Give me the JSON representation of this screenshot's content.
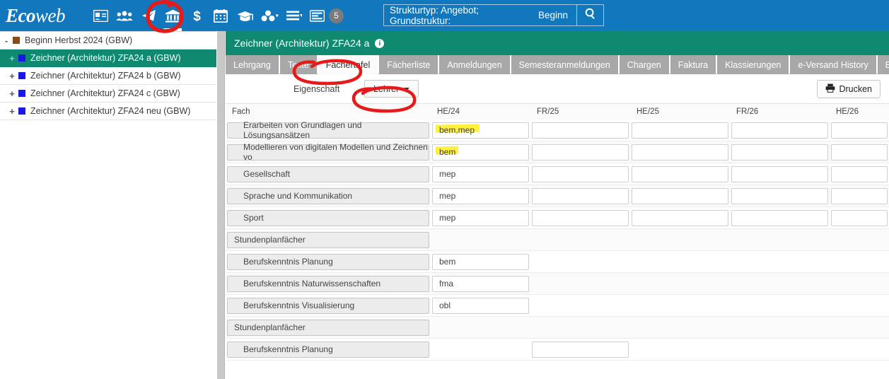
{
  "app": {
    "brand_eco": "Eco",
    "brand_web": "web"
  },
  "topbar": {
    "icons": [
      {
        "name": "id-card-icon",
        "label": "Kontakte"
      },
      {
        "name": "users-icon",
        "label": "Personengruppen"
      },
      {
        "name": "paper-plane-icon",
        "label": "Versand"
      },
      {
        "name": "bank-icon",
        "label": "Institution"
      },
      {
        "name": "dollar-icon",
        "label": "Finanzen"
      },
      {
        "name": "calendar-icon",
        "label": "Kalender"
      },
      {
        "name": "graduation-cap-icon",
        "label": "Ausbildung"
      },
      {
        "name": "sitemap-icon",
        "label": "Struktur"
      },
      {
        "name": "list-icon",
        "label": "Listen"
      },
      {
        "name": "tasks-icon",
        "label": "Aufgaben"
      }
    ],
    "badge_count": "5"
  },
  "search": {
    "label": "Strukturtyp: Angebot; Grundstruktur:",
    "value": "Beginn",
    "button_icon": "search-icon"
  },
  "sidebar": {
    "nodes": [
      {
        "label": "Beginn Herbst 2024 (GBW)",
        "expander": "-",
        "color": "brown",
        "level": 1,
        "selected": false
      },
      {
        "label": "Zeichner (Architektur) ZFA24 a (GBW)",
        "expander": "+",
        "color": "blue",
        "level": 2,
        "selected": true
      },
      {
        "label": "Zeichner (Architektur) ZFA24 b (GBW)",
        "expander": "+",
        "color": "blue",
        "level": 2,
        "selected": false
      },
      {
        "label": "Zeichner (Architektur) ZFA24 c (GBW)",
        "expander": "+",
        "color": "blue",
        "level": 2,
        "selected": false
      },
      {
        "label": "Zeichner (Architektur) ZFA24 neu (GBW)",
        "expander": "+",
        "color": "blue",
        "level": 2,
        "selected": false
      }
    ]
  },
  "panel": {
    "title": "Zeichner (Architektur) ZFA24 a",
    "info_icon": "info-icon",
    "tabs": [
      {
        "label": "Lehrgang",
        "active": false
      },
      {
        "label": "Texte",
        "active": false
      },
      {
        "label": "Fächertafel",
        "active": true
      },
      {
        "label": "Fächerliste",
        "active": false
      },
      {
        "label": "Anmeldungen",
        "active": false
      },
      {
        "label": "Semesteranmeldungen",
        "active": false
      },
      {
        "label": "Chargen",
        "active": false
      },
      {
        "label": "Faktura",
        "active": false
      },
      {
        "label": "Klassierungen",
        "active": false
      },
      {
        "label": "e-Versand History",
        "active": false
      },
      {
        "label": "Berichte",
        "active": false
      }
    ],
    "toolbar": {
      "eigenschaft_label": "Eigenschaft",
      "dropdown_value": "Lehrer",
      "print_label": "Drucken",
      "print_icon": "printer-icon"
    }
  },
  "table": {
    "columns": [
      "Fach",
      "HE/24",
      "FR/25",
      "HE/25",
      "FR/26",
      "HE/26"
    ],
    "rows": [
      {
        "fach": "Erarbeiten von Grundlagen und Lösungsansätzen",
        "indent": true,
        "group": false,
        "values": [
          "bem,mep",
          "",
          "",
          "",
          ""
        ],
        "boxes": [
          true,
          true,
          true,
          true,
          true
        ],
        "highlight": 0
      },
      {
        "fach": "Modellieren von digitalen Modellen und Zeichnen vo",
        "indent": true,
        "group": false,
        "values": [
          "bem",
          "",
          "",
          "",
          ""
        ],
        "boxes": [
          true,
          true,
          true,
          true,
          true
        ],
        "highlight": 0
      },
      {
        "fach": "Gesellschaft",
        "indent": true,
        "group": false,
        "values": [
          "mep",
          "",
          "",
          "",
          ""
        ],
        "boxes": [
          true,
          true,
          true,
          true,
          true
        ],
        "highlight": -1
      },
      {
        "fach": "Sprache und Kommunikation",
        "indent": true,
        "group": false,
        "values": [
          "mep",
          "",
          "",
          "",
          ""
        ],
        "boxes": [
          true,
          true,
          true,
          true,
          true
        ],
        "highlight": -1
      },
      {
        "fach": "Sport",
        "indent": true,
        "group": false,
        "values": [
          "mep",
          "",
          "",
          "",
          ""
        ],
        "boxes": [
          true,
          true,
          true,
          true,
          true
        ],
        "highlight": -1
      },
      {
        "fach": "Stundenplanfächer",
        "indent": false,
        "group": true,
        "values": [
          "",
          "",
          "",
          "",
          ""
        ],
        "boxes": [
          false,
          false,
          false,
          false,
          false
        ],
        "highlight": -1
      },
      {
        "fach": "Berufskenntnis Planung",
        "indent": true,
        "group": false,
        "values": [
          "bem",
          "",
          "",
          "",
          ""
        ],
        "boxes": [
          true,
          false,
          false,
          false,
          false
        ],
        "highlight": -1
      },
      {
        "fach": "Berufskenntnis Naturwissenschaften",
        "indent": true,
        "group": false,
        "values": [
          "fma",
          "",
          "",
          "",
          ""
        ],
        "boxes": [
          true,
          false,
          false,
          false,
          false
        ],
        "highlight": -1
      },
      {
        "fach": "Berufskenntnis Visualisierung",
        "indent": true,
        "group": false,
        "values": [
          "obl",
          "",
          "",
          "",
          ""
        ],
        "boxes": [
          true,
          false,
          false,
          false,
          false
        ],
        "highlight": -1
      },
      {
        "fach": "Stundenplanfächer",
        "indent": false,
        "group": true,
        "values": [
          "",
          "",
          "",
          "",
          ""
        ],
        "boxes": [
          false,
          false,
          false,
          false,
          false
        ],
        "highlight": -1
      },
      {
        "fach": "Berufskenntnis Planung",
        "indent": true,
        "group": false,
        "values": [
          "",
          "",
          "",
          "",
          ""
        ],
        "boxes": [
          false,
          true,
          false,
          false,
          false
        ],
        "highlight": -1
      }
    ]
  },
  "annotations": {
    "accent_red": "#e81919",
    "highlight_yellow": "#ffef2e",
    "marks": [
      {
        "name": "annotation-circle-bank-icon",
        "shape": "ellipse"
      },
      {
        "name": "annotation-circle-faechertafel-tab",
        "shape": "ellipse"
      },
      {
        "name": "annotation-circle-lehrer-dropdown",
        "shape": "ellipse"
      }
    ]
  }
}
